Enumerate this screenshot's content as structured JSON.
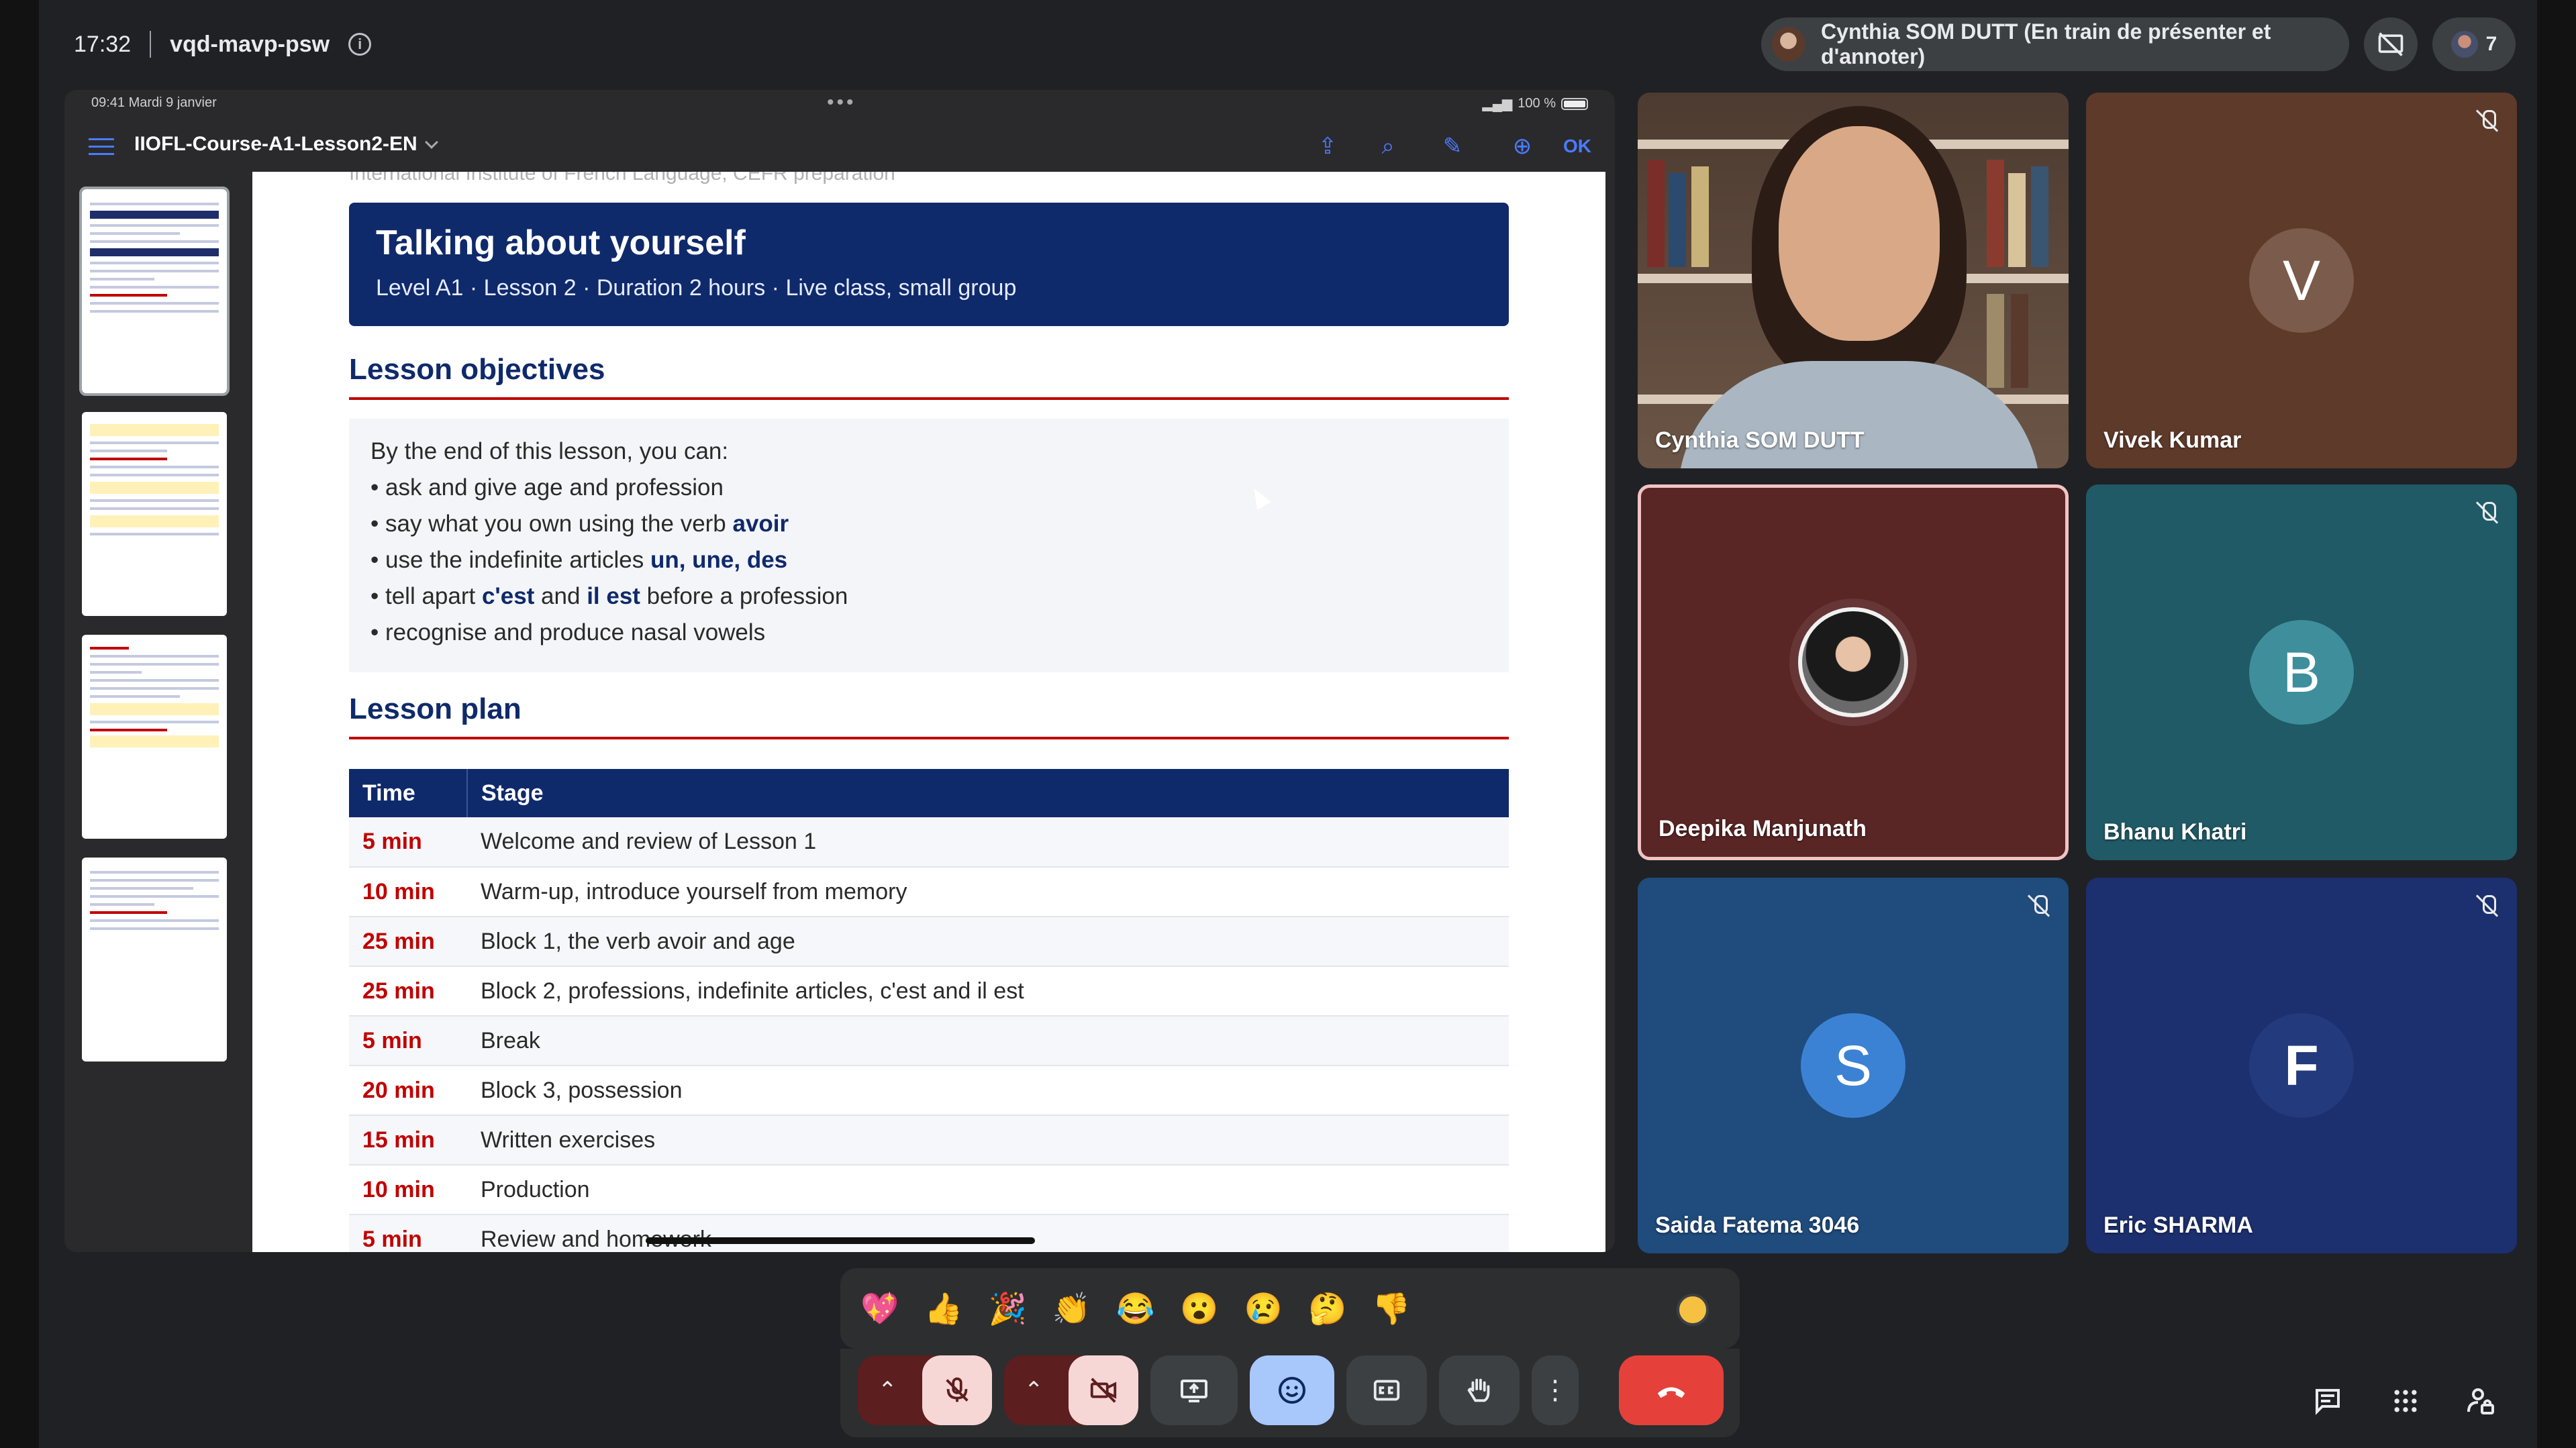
{
  "meeting": {
    "time": "17:32",
    "code": "vqd-mavp-psw",
    "presenter_label": "Cynthia SOM DUTT (En train de présenter et d'annoter)",
    "participant_count": "7"
  },
  "ipad": {
    "status_time": "09:41  Mardi 9 janvier",
    "battery": "100 %",
    "doc_title": "IIOFL-Course-A1-Lesson2-EN",
    "ok_label": "OK"
  },
  "doc": {
    "cut_header": "International Institute of French Language, CEFR preparation",
    "banner_title": "Talking about yourself",
    "banner_subtitle": "Level A1  ·  Lesson 2  ·  Duration 2 hours  ·  Live class, small group",
    "objectives_heading": "Lesson objectives",
    "objectives_intro": "By the end of this lesson, you can:",
    "objectives": [
      {
        "pre": "ask and give age and profession",
        "bold": "",
        "post": ""
      },
      {
        "pre": "say what you own using the verb ",
        "bold": "avoir",
        "post": ""
      },
      {
        "pre": "use the indefinite articles ",
        "bold": "un, une, des",
        "post": ""
      },
      {
        "pre": "tell apart ",
        "bold": "c'est",
        "post": " and "
      },
      {
        "pre": "recognise and produce nasal vowels",
        "bold": "",
        "post": ""
      }
    ],
    "obj4_bold2": "il est",
    "obj4_tail": " before a profession",
    "plan_heading": "Lesson plan",
    "plan_columns": [
      "Time",
      "Stage"
    ],
    "plan_rows": [
      {
        "time": "5 min",
        "stage": "Welcome and review of Lesson 1"
      },
      {
        "time": "10 min",
        "stage": "Warm-up, introduce yourself from memory"
      },
      {
        "time": "25 min",
        "stage": "Block 1, the verb avoir and age"
      },
      {
        "time": "25 min",
        "stage": "Block 2, professions, indefinite articles, c'est and il est"
      },
      {
        "time": "5 min",
        "stage": "Break"
      },
      {
        "time": "20 min",
        "stage": "Block 3, possession"
      },
      {
        "time": "15 min",
        "stage": "Written exercises"
      },
      {
        "time": "10 min",
        "stage": "Production"
      },
      {
        "time": "5 min",
        "stage": "Review and homework"
      }
    ]
  },
  "participants": [
    {
      "name": "Cynthia SOM DUTT",
      "kind": "camera"
    },
    {
      "name": "Vivek Kumar",
      "letter": "V",
      "bg": "#5e3a2a",
      "avatar": "#7a5b4c",
      "muted": true
    },
    {
      "name": "Deepika Manjunath",
      "kind": "photo",
      "bg": "#5a2525",
      "speaking": true
    },
    {
      "name": "Bhanu Khatri",
      "letter": "B",
      "bg": "#1f5a66",
      "avatar": "#3f8e9c",
      "muted": true
    },
    {
      "name": "Saida Fatema 3046",
      "letter": "S",
      "bg": "#1f4b7d",
      "avatar": "#3c82d4",
      "muted": true
    },
    {
      "name": "Eric SHARMA",
      "letter": "F",
      "bg": "#1c2f6e",
      "avatar": "#233a7c",
      "muted": true
    }
  ],
  "reactions": [
    "💖",
    "👍",
    "🎉",
    "👏",
    "😂",
    "😮",
    "😢",
    "🤔",
    "👎"
  ],
  "colors": {
    "accent_red": "#c00000",
    "navy": "#0f2a6b",
    "end_call": "#e5413a",
    "emoji_active": "#a8c7fa"
  }
}
